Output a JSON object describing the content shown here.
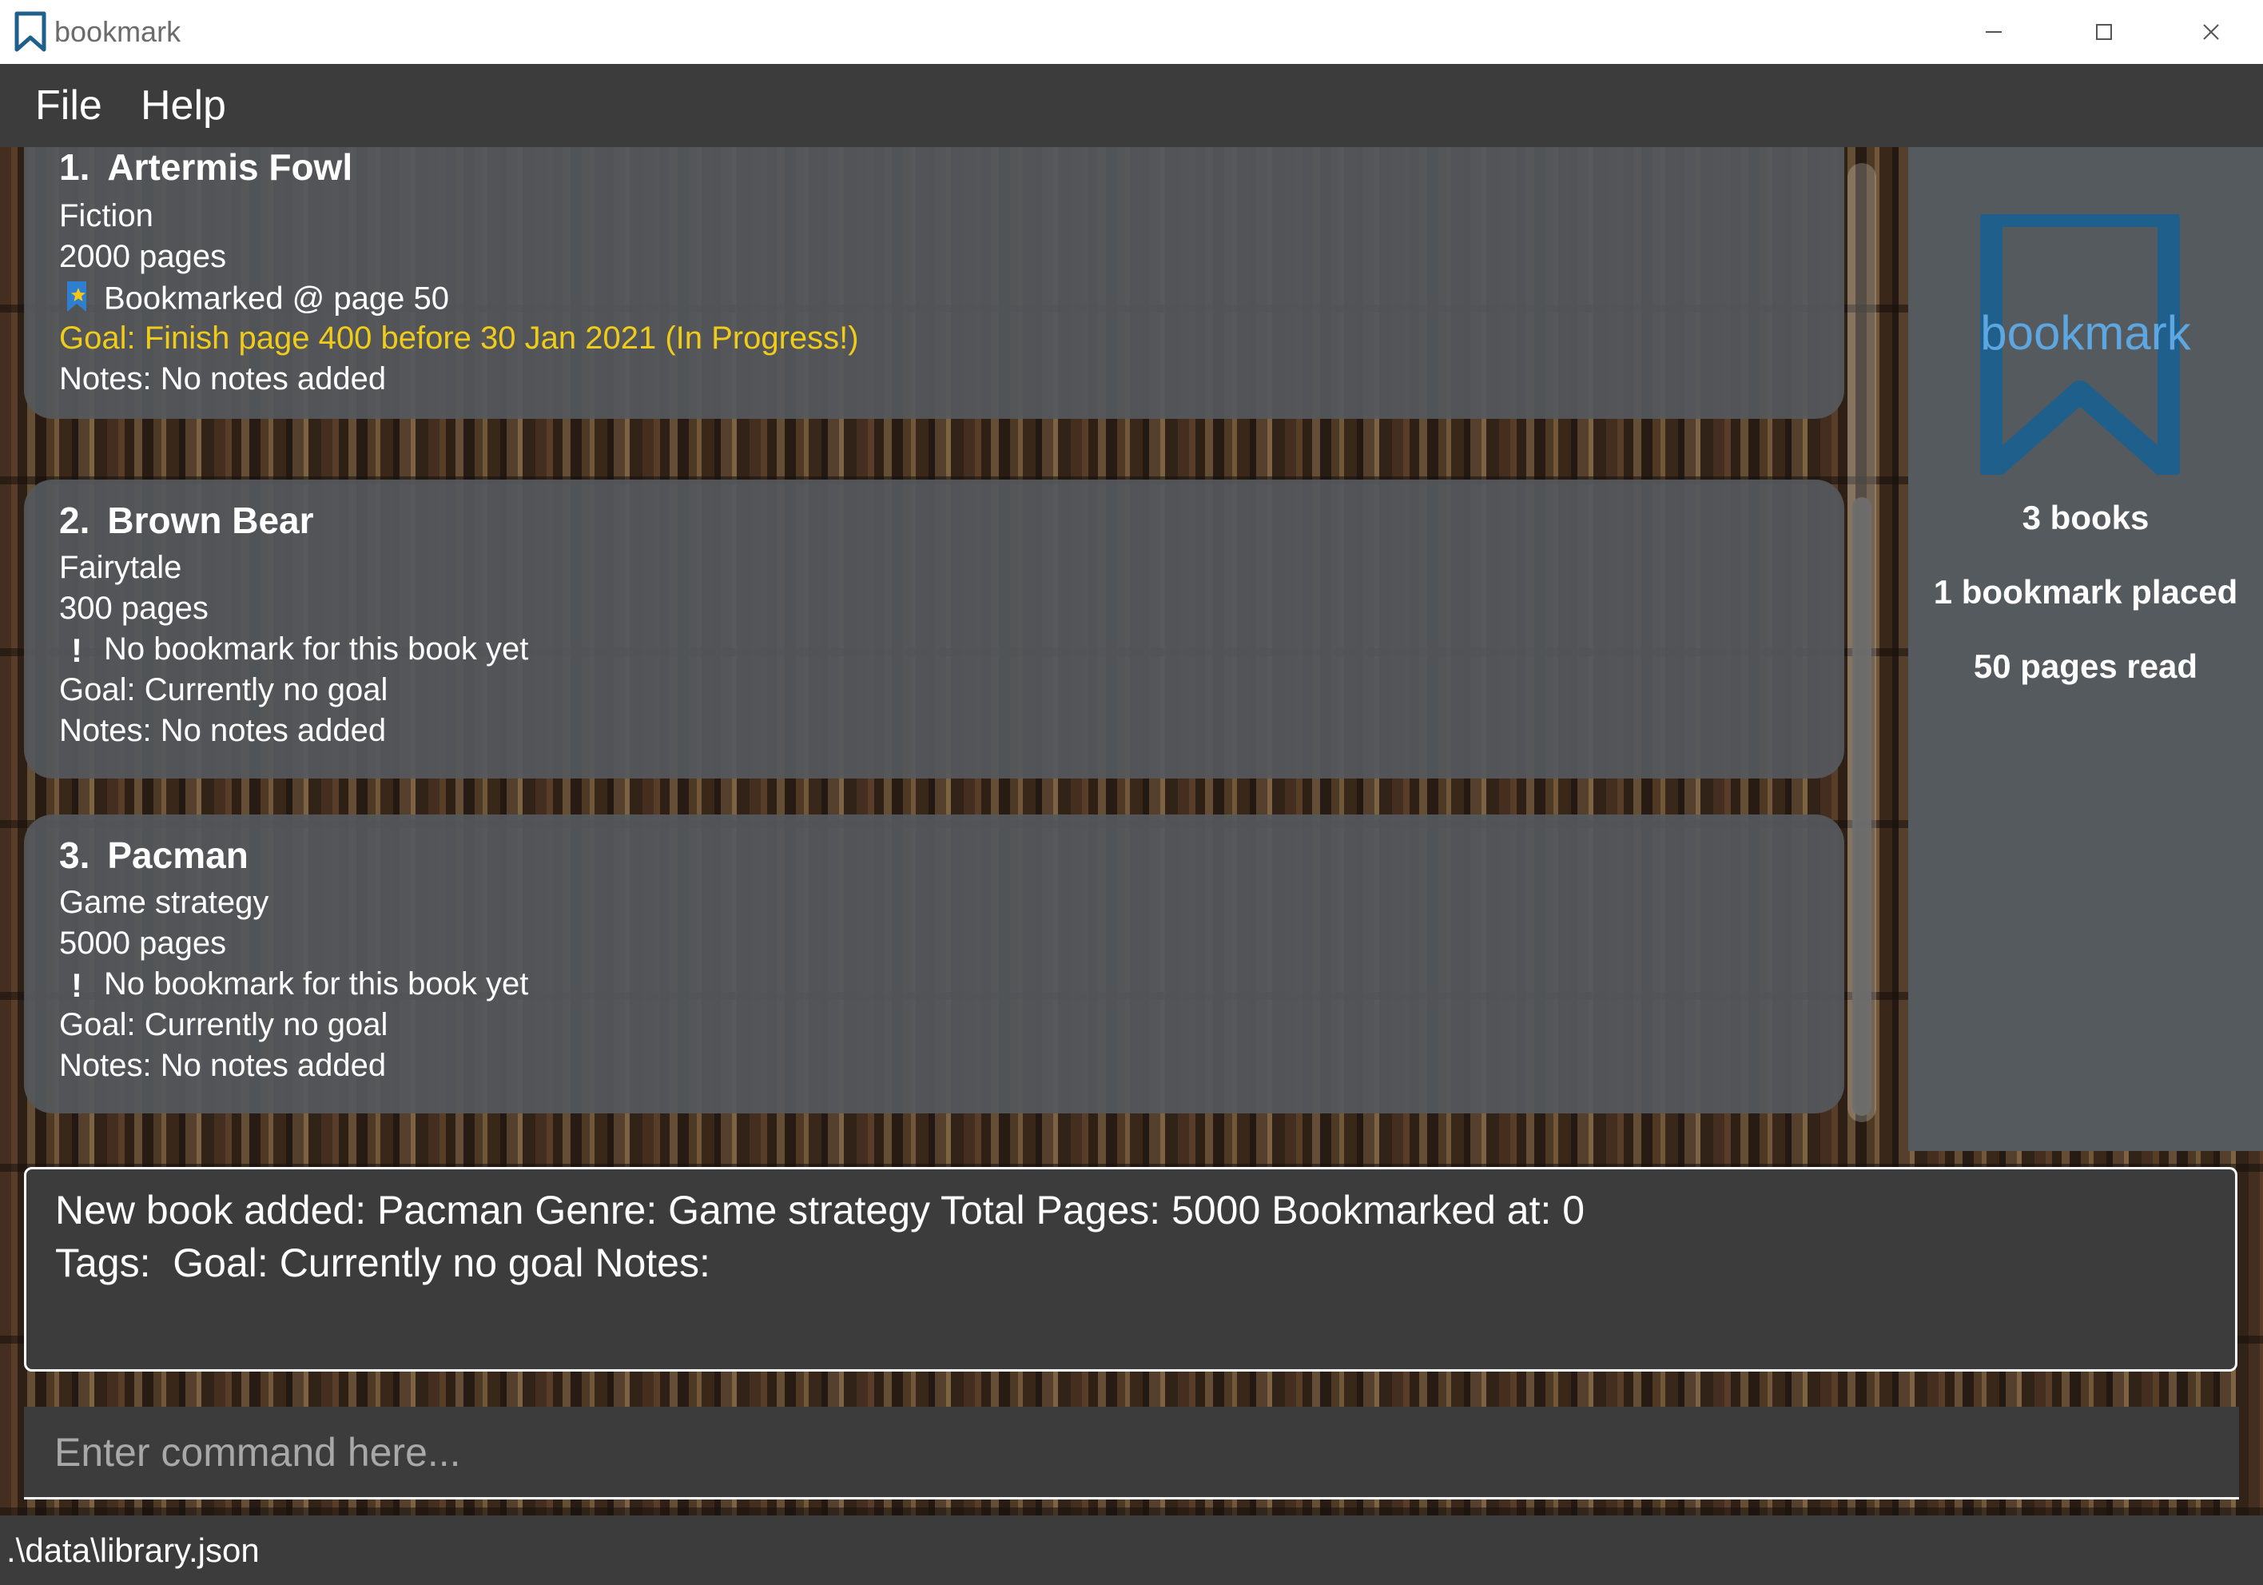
{
  "window": {
    "title": "bookmark",
    "accent": "#1f5f8b"
  },
  "menu": {
    "file": "File",
    "help": "Help"
  },
  "books": [
    {
      "index": "1.",
      "title": "Artermis Fowl",
      "genre": "Fiction",
      "pages": "2000 pages",
      "bookmark_icon": "bookmark-star-icon",
      "bookmark": "Bookmarked @ page 50",
      "goal": "Goal: Finish page 400 before 30 Jan 2021 (In Progress!)",
      "goal_color": "#f0cc1a",
      "notes": "Notes: No notes added"
    },
    {
      "index": "2.",
      "title": "Brown Bear",
      "genre": "Fairytale",
      "pages": "300 pages",
      "bookmark_icon": "exclamation-icon",
      "bookmark": "No bookmark for this book yet",
      "goal": "Goal: Currently no goal",
      "notes": "Notes: No notes added"
    },
    {
      "index": "3.",
      "title": "Pacman",
      "genre": "Game strategy",
      "pages": "5000 pages",
      "bookmark_icon": "exclamation-icon",
      "bookmark": "No bookmark for this book yet",
      "goal": "Goal: Currently no goal",
      "notes": "Notes: No notes added"
    }
  ],
  "stats": {
    "logo_text": "bookmark",
    "logo_color": "#1f5f8b",
    "books": "3 books",
    "bookmarks": "1 bookmark placed",
    "pages_read": "50 pages read"
  },
  "result": {
    "line1": "New book added: Pacman Genre: Game strategy Total Pages: 5000 Bookmarked at: 0",
    "line2": "Tags:  Goal: Currently no goal Notes:"
  },
  "command": {
    "placeholder": "Enter command here..."
  },
  "status": {
    "path": ".\\data\\library.json"
  }
}
